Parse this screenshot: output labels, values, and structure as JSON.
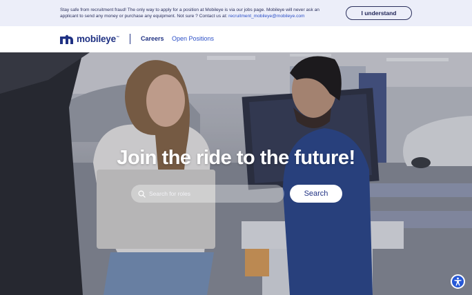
{
  "banner": {
    "text": "Stay safe from recruitment fraud! The only way to apply for a position at Mobileye is via our jobs page. Mobileye will never ask an applicant to send any money or purchase any equipment. Not sure ? Contact us at:",
    "email": "recruitment_mobileye@mobileye.com",
    "button_label": "I understand"
  },
  "nav": {
    "logo_text": "mobileye",
    "logo_tm": "™",
    "careers_label": "Careers",
    "open_positions_label": "Open Positions"
  },
  "hero": {
    "title": "Join the ride to the future!",
    "search_placeholder": "Search for roles",
    "search_button_label": "Search"
  },
  "colors": {
    "brand": "#1f3183",
    "link": "#2b4fc7",
    "banner_bg": "#eceef9",
    "accessibility": "#2658d6"
  },
  "icons": {
    "logo": "mobileye-logo-icon",
    "search": "search-icon",
    "accessibility": "accessibility-icon"
  }
}
